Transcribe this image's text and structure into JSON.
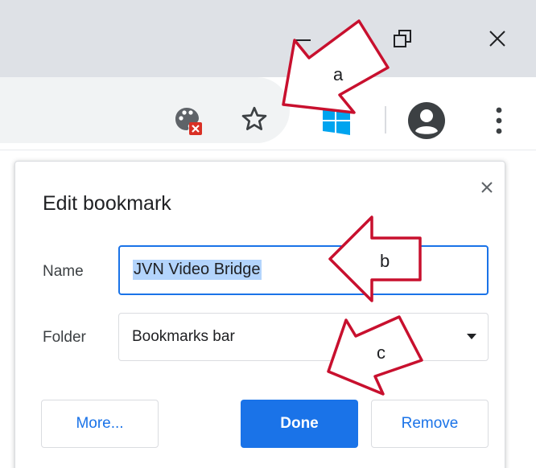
{
  "window": {
    "minimize_label": "Minimize",
    "restore_label": "Restore",
    "close_label": "Close"
  },
  "toolbar": {
    "icons": [
      "blocked-content-icon",
      "star-icon",
      "windows-extension-icon",
      "profile-icon",
      "more-menu-icon"
    ]
  },
  "bubble": {
    "title": "Edit bookmark",
    "close_glyph": "✕",
    "name_label": "Name",
    "name_value": "JVN Video Bridge",
    "folder_label": "Folder",
    "folder_value": "Bookmarks bar",
    "more_button": "More...",
    "done_button": "Done",
    "remove_button": "Remove"
  },
  "annotations": {
    "a": "a",
    "b": "b",
    "c": "c"
  },
  "colors": {
    "accent": "#1a73e8",
    "titlebar": "#dee1e6",
    "omnibox": "#f1f3f4",
    "arrow": "#c8102e",
    "selection": "#b3d4fc"
  }
}
